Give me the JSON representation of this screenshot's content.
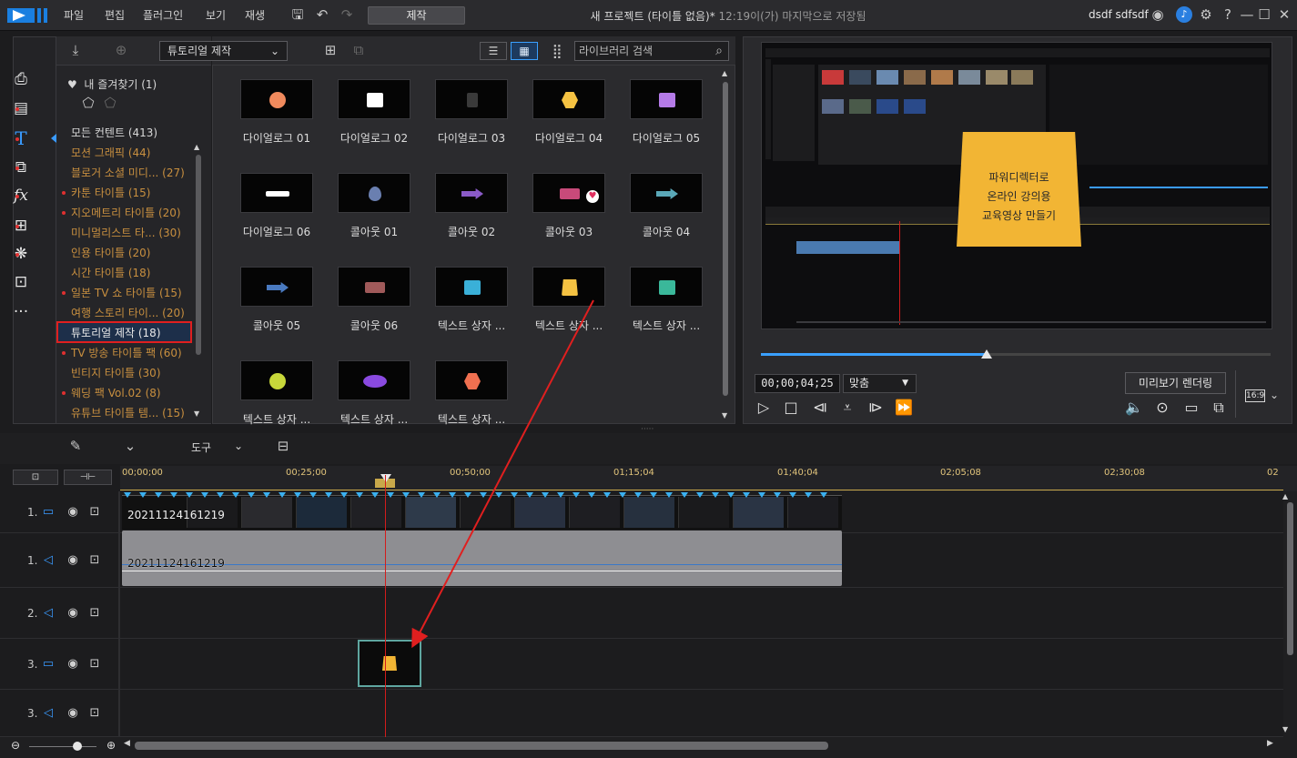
{
  "menu": [
    "파일",
    "편집",
    "플러그인",
    "보기",
    "재생"
  ],
  "mode_button": "제작",
  "window_title": "새 프로젝트 (타이틀 없음)*",
  "save_status": "12:19이(가) 마지막으로 저장됨",
  "user_name": "dsdf sdfsdf",
  "room_select": "튜토리얼 제작",
  "library_search_placeholder": "라이브러리 검색",
  "favorites": "내 즐겨찾기 (1)",
  "tree": [
    {
      "label": "모든 컨텐트 (413)",
      "dot": false,
      "style": "white"
    },
    {
      "label": "모션 그래픽  (44)",
      "dot": false,
      "style": "orange"
    },
    {
      "label": "블로거 소셜 미디...  (27)",
      "dot": false,
      "style": "orange"
    },
    {
      "label": "카툰 타이틀  (15)",
      "dot": true,
      "style": "orange"
    },
    {
      "label": "지오메트리 타이틀  (20)",
      "dot": true,
      "style": "orange"
    },
    {
      "label": "미니멀리스트 타...  (30)",
      "dot": false,
      "style": "orange"
    },
    {
      "label": "인용 타이틀  (20)",
      "dot": false,
      "style": "orange"
    },
    {
      "label": "시간 타이틀  (18)",
      "dot": false,
      "style": "orange"
    },
    {
      "label": "일본 TV 쇼 타이틀  (15)",
      "dot": true,
      "style": "orange"
    },
    {
      "label": "여행 스토리 타이...  (20)",
      "dot": false,
      "style": "orange"
    },
    {
      "label": "튜토리얼 제작  (18)",
      "dot": false,
      "style": "orange"
    },
    {
      "label": "TV 방송 타이틀 팩  (60)",
      "dot": true,
      "style": "orange"
    },
    {
      "label": "빈티지 타이틀  (30)",
      "dot": false,
      "style": "orange"
    },
    {
      "label": "웨딩 팩 Vol.02  (8)",
      "dot": true,
      "style": "orange"
    },
    {
      "label": "유튜브 타이틀 템...  (15)",
      "dot": false,
      "style": "orange"
    }
  ],
  "grid_items": [
    {
      "label": "다이얼로그 01",
      "shape": "circle",
      "color": "#f08a5d"
    },
    {
      "label": "다이얼로그 02",
      "shape": "rect",
      "color": "#ffffff"
    },
    {
      "label": "다이얼로그 03",
      "shape": "clip",
      "color": "#3a3a3a"
    },
    {
      "label": "다이얼로그 04",
      "shape": "hex",
      "color": "#f5c242"
    },
    {
      "label": "다이얼로그 05",
      "shape": "rect",
      "color": "#b57be8"
    },
    {
      "label": "다이얼로그 06",
      "shape": "bar",
      "color": "#ffffff"
    },
    {
      "label": "콜아웃 01",
      "shape": "pin",
      "color": "#6a7fb0"
    },
    {
      "label": "콜아웃 02",
      "shape": "arrow",
      "color": "#8a5ac8"
    },
    {
      "label": "콜아웃 03",
      "shape": "sign",
      "color": "#c84a7a"
    },
    {
      "label": "콜아웃 04",
      "shape": "arrow",
      "color": "#5aa8b8"
    },
    {
      "label": "콜아웃 05",
      "shape": "arrow",
      "color": "#4a7ac0"
    },
    {
      "label": "콜아웃 06",
      "shape": "sign",
      "color": "#a05a5a"
    },
    {
      "label": "텍스트 상자 ...",
      "shape": "rect",
      "color": "#3ab0d8"
    },
    {
      "label": "텍스트 상자 ...",
      "shape": "trap",
      "color": "#f5c242"
    },
    {
      "label": "텍스트 상자 ...",
      "shape": "rect",
      "color": "#3ab89a"
    },
    {
      "label": "텍스트 상자 ...",
      "shape": "circle",
      "color": "#c8d83a"
    },
    {
      "label": "텍스트 상자 ...",
      "shape": "ellipse",
      "color": "#8a4ae0"
    },
    {
      "label": "텍스트 상자 ...",
      "shape": "hex",
      "color": "#f07050"
    }
  ],
  "preview_card_lines": [
    "파워디렉터로",
    "온라인 강의용",
    "교육영상 만들기"
  ],
  "timecode": "00;00;04;25",
  "fit_select": "맞춤",
  "render_button": "미리보기 렌더링",
  "aspect": "16:9",
  "tools_label": "도구",
  "ruler": [
    "00;00;00",
    "00;25;00",
    "00;50;00",
    "01;15;04",
    "01;40;04",
    "02;05;08",
    "02;30;08",
    "02"
  ],
  "tracks": [
    "1.",
    "1.",
    "2.",
    "3.",
    "3."
  ],
  "video_clip_label": "20211124161219",
  "audio_clip_label": "20211124161219",
  "colors": {
    "accent": "#3aa0ff",
    "selection": "#e01f1f",
    "playhead": "#d21c1c",
    "title_orange": "#c88f3f"
  }
}
